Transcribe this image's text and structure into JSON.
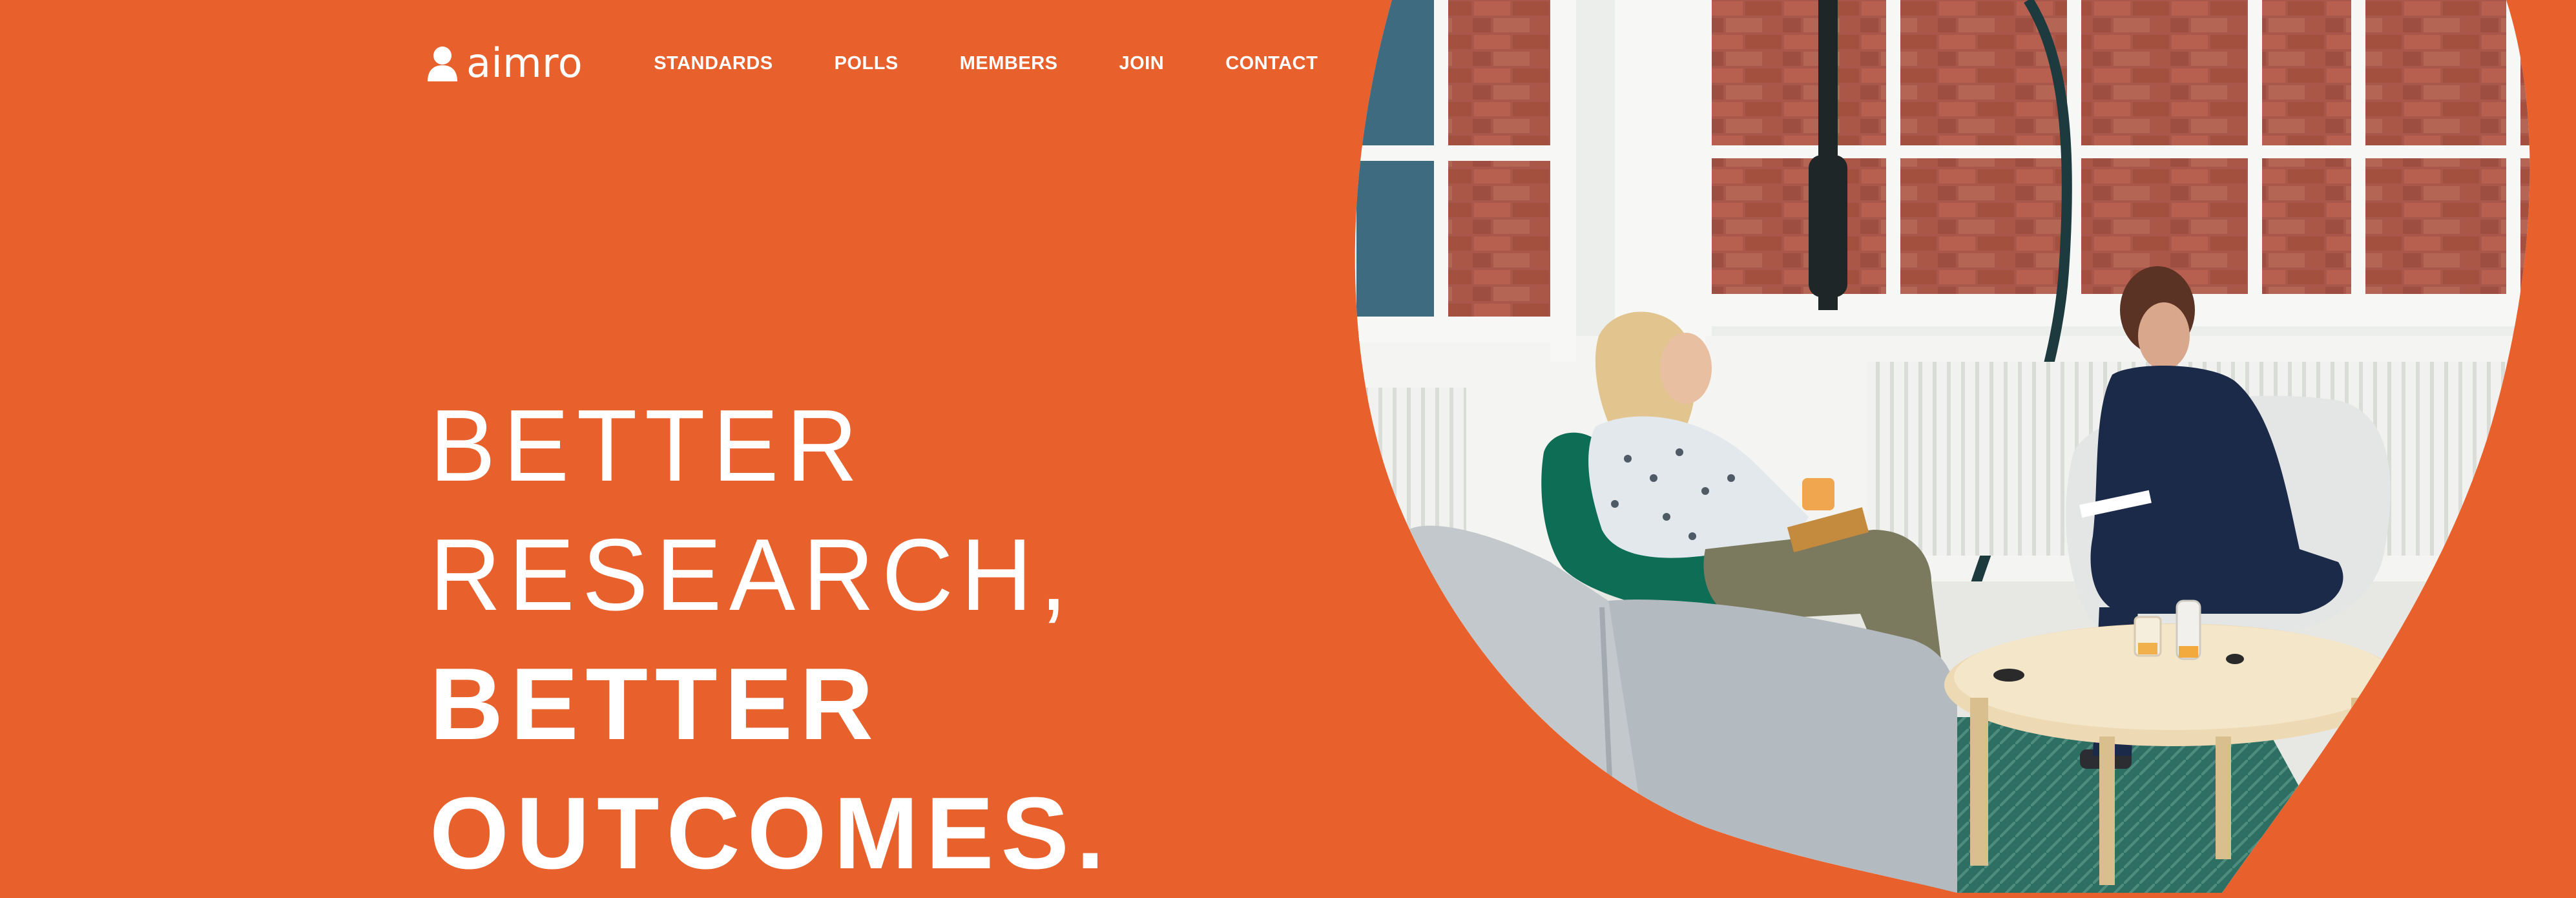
{
  "brand": {
    "logo_text": "aimro",
    "logo_icon": "person-icon"
  },
  "nav": {
    "items": [
      {
        "label": "STANDARDS"
      },
      {
        "label": "POLLS"
      },
      {
        "label": "MEMBERS"
      },
      {
        "label": "JOIN"
      },
      {
        "label": "CONTACT"
      }
    ]
  },
  "hero": {
    "line1": "BETTER",
    "line2": "RESEARCH,",
    "line3": "BETTER",
    "line4": "OUTCOMES."
  },
  "photo": {
    "subject": "office-meeting-photo"
  },
  "colors": {
    "background": "#E8602C",
    "text": "#FFFFFF"
  }
}
